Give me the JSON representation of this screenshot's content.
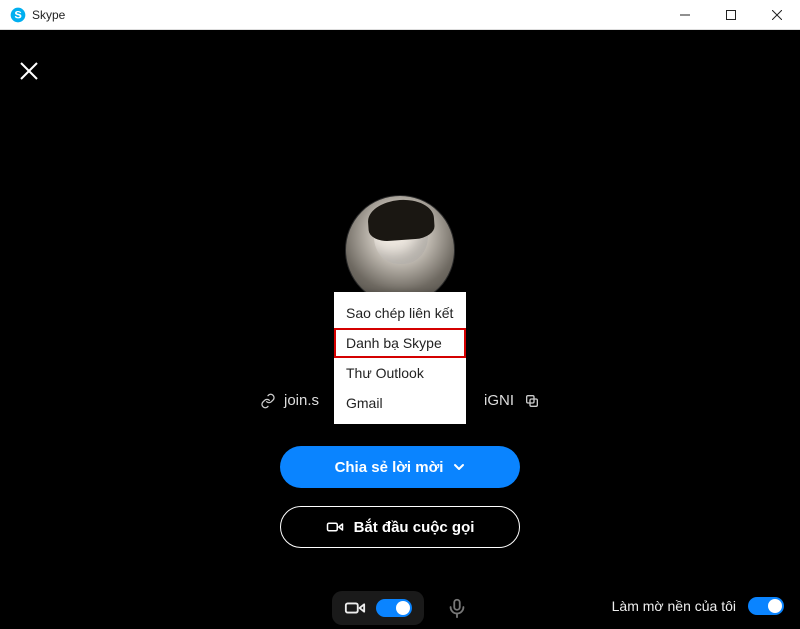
{
  "window": {
    "title": "Skype"
  },
  "link_row": {
    "left_text": "join.s",
    "right_text": "iGNI"
  },
  "menu": {
    "items": [
      {
        "label": "Sao chép liên kết",
        "highlight": false
      },
      {
        "label": "Danh bạ Skype",
        "highlight": true
      },
      {
        "label": "Thư Outlook",
        "highlight": false
      },
      {
        "label": "Gmail",
        "highlight": false
      }
    ]
  },
  "buttons": {
    "share_invite": "Chia sẻ lời mời",
    "start_call": "Bắt đầu cuộc gọi"
  },
  "bottom": {
    "blur_label": "Làm mờ nền của tôi"
  }
}
